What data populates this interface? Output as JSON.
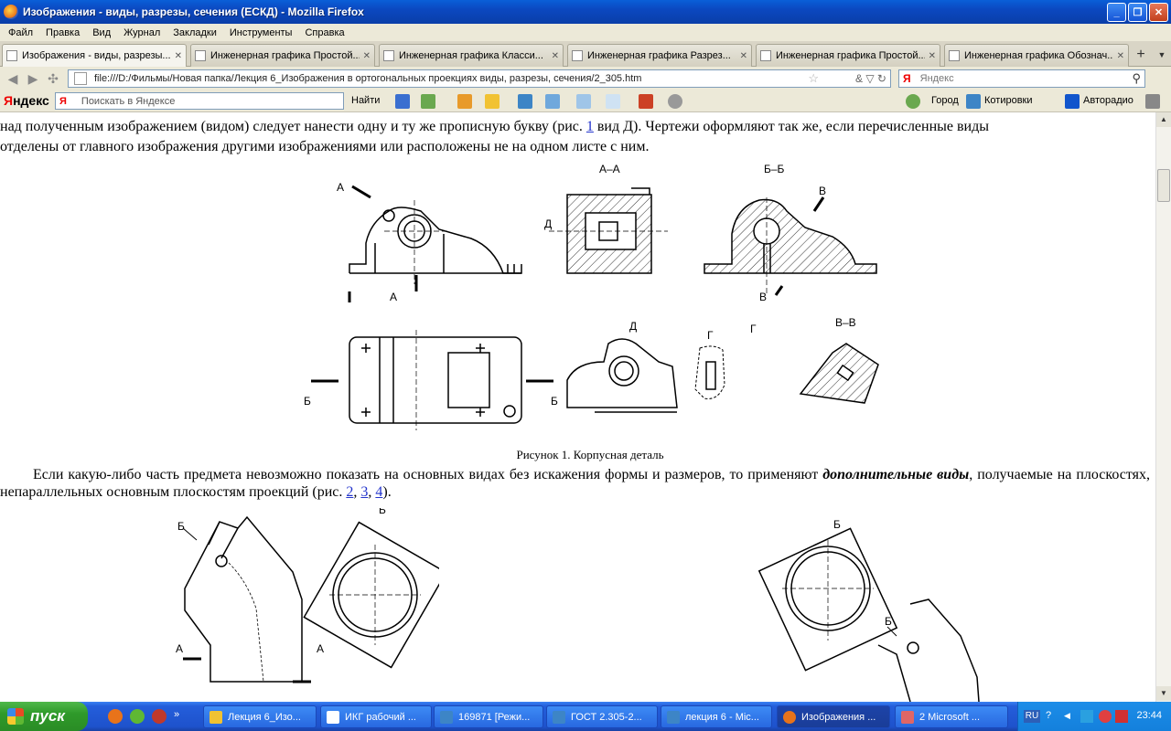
{
  "window": {
    "title": "Изображения - виды, разрезы, сечения (ЕСКД) - Mozilla Firefox"
  },
  "menu": [
    "Файл",
    "Правка",
    "Вид",
    "Журнал",
    "Закладки",
    "Инструменты",
    "Справка"
  ],
  "tabs": [
    {
      "label": "Изображения - виды, разрезы..."
    },
    {
      "label": "Инженерная графика Простой..."
    },
    {
      "label": "Инженерная графика Класси..."
    },
    {
      "label": "Инженерная графика Разрез..."
    },
    {
      "label": "Инженерная графика Простой..."
    },
    {
      "label": "Инженерная графика Обознач..."
    }
  ],
  "nav": {
    "url": "file:///D:/Фильмы/Новая папка/Лекция 6_Изображения в ортогональных проекциях виды, разрезы, сечения/2_305.htm",
    "search_placeholder": "Яндекс",
    "search_engine": "Я"
  },
  "yandex_bar": {
    "logo_red": "Я",
    "logo_black": "ндекс",
    "search_placeholder": "Поискать в Яндексе",
    "search_engine": "Я",
    "find_label": "Найти",
    "city_label": "Город",
    "quotes_label": "Котировки",
    "radio_label": "Авторадио"
  },
  "article": {
    "para1_line1": "над полученным изображением (видом) следует нанести одну и ту же прописную букву (рис. ",
    "para1_link": "1",
    "para1_line1_end": " вид Д). Чертежи оформляют так же, если перечисленные виды",
    "para1_line2": "отделены от главного изображения другими изображениями или расположены не на одном листе с ним.",
    "figure1_caption": "Рисунок 1. Корпусная деталь",
    "para2_start": "Если какую-либо часть предмета невозможно показать на основных видах без искажения формы и размеров, то применяют ",
    "para2_em": "дополнительные виды",
    "para2_mid": ", получаемые на плоскостях, непараллельных основным плоскостям проекций (рис. ",
    "para2_link2": "2",
    "para2_link3": "3",
    "para2_link4": "4",
    "para2_end": ").",
    "sep1": ", ",
    "sep2": ", "
  },
  "drawing_labels": {
    "a_a": "А–А",
    "b_b": "Б–Б",
    "v_v": "В–В",
    "a": "А",
    "b": "Б",
    "v": "В",
    "d": "Д",
    "g": "Г"
  },
  "taskbar": {
    "start": "пуск",
    "tasks": [
      "Лекция 6_Изо...",
      "ИКГ рабочий ...",
      "169871 [Режи...",
      "ГОСТ 2.305-2...",
      "лекция 6 - Mic...",
      "Изображения ...",
      "2 Microsoft ..."
    ],
    "lang": "RU",
    "clock": "23:44"
  }
}
